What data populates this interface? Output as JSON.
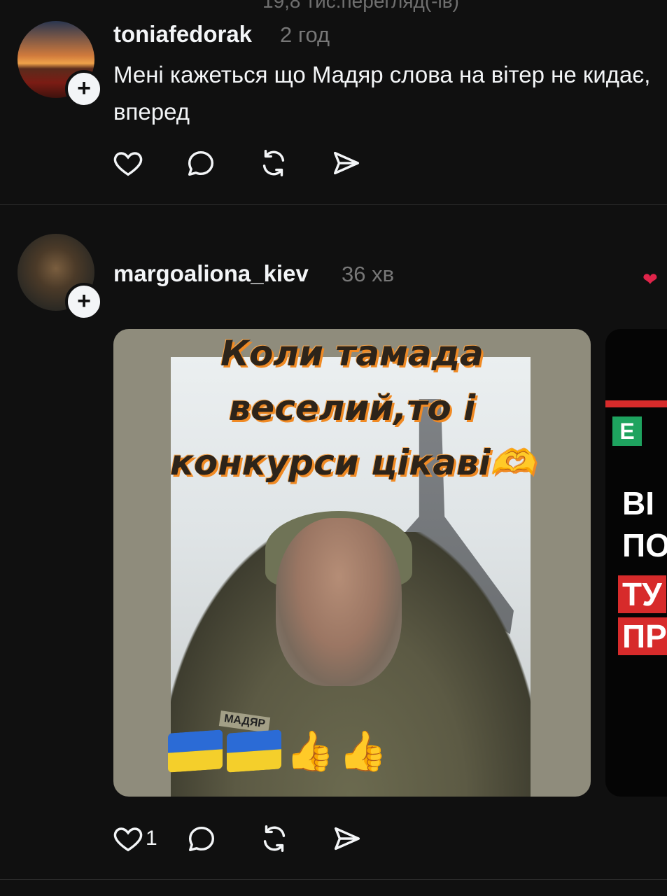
{
  "header": {
    "views_text": "19,8 тис.перегляд(-ів)"
  },
  "posts": [
    {
      "username": "toniafedorak",
      "time": "2 год",
      "text": "Мені кажеться що Мадяр слова на вітер не кидає, вперед",
      "actions": {
        "like_count": ""
      }
    },
    {
      "username": "margoaliona_kiev",
      "time": "36 хв",
      "meme_lines": [
        "Коли тамада",
        "веселий,то і",
        "конкурси цікаві🫶"
      ],
      "patch_text": "МАДЯР",
      "side_lines": [
        "ВІ",
        "ПО",
        "ТУ",
        "ПР"
      ],
      "side_logo": "Е",
      "actions": {
        "like_count": "1"
      }
    }
  ],
  "icons": {
    "like": "heart-icon",
    "comment": "comment-icon",
    "repost": "repost-icon",
    "share": "send-icon",
    "follow": "plus-icon"
  },
  "colors": {
    "background": "#101010",
    "text": "#f3f5f7",
    "muted": "#777777",
    "accent_heart": "#e0244a"
  }
}
